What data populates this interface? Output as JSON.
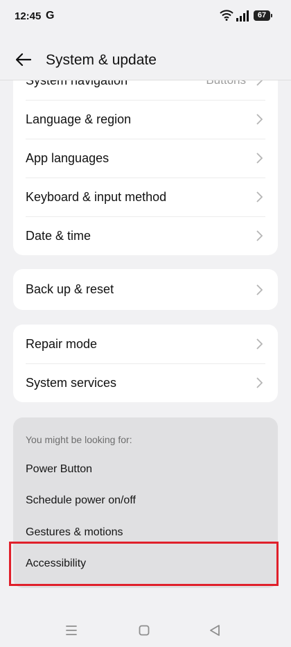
{
  "status_bar": {
    "time": "12:45",
    "g_label": "G",
    "battery": "67"
  },
  "header": {
    "title": "System & update"
  },
  "card1": {
    "items": [
      {
        "label": "System navigation",
        "value": "Buttons"
      },
      {
        "label": "Language & region"
      },
      {
        "label": "App languages"
      },
      {
        "label": "Keyboard & input method"
      },
      {
        "label": "Date & time"
      }
    ]
  },
  "card2": {
    "items": [
      {
        "label": "Back up & reset"
      }
    ]
  },
  "card3": {
    "items": [
      {
        "label": "Repair mode"
      },
      {
        "label": "System services"
      }
    ]
  },
  "suggestions": {
    "title": "You might be looking for:",
    "items": [
      "Power Button",
      "Schedule power on/off",
      "Gestures & motions",
      "Accessibility"
    ]
  },
  "colors": {
    "highlight": "#e0202b",
    "background": "#f1f1f3",
    "card": "#ffffff"
  }
}
